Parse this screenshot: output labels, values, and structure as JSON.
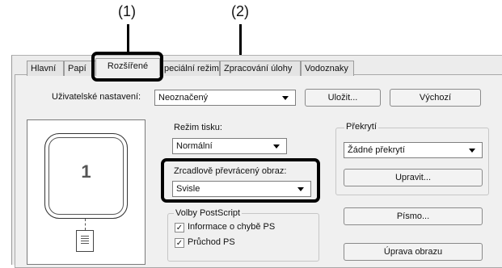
{
  "callouts": [
    "(1)",
    "(2)"
  ],
  "tabs": [
    {
      "label": "Hlavní"
    },
    {
      "label": "Papí"
    },
    {
      "label": "Rozšířené"
    },
    {
      "label": "peciální režimy"
    },
    {
      "label": "Zpracování úlohy"
    },
    {
      "label": "Vodoznaky"
    }
  ],
  "user_settings": {
    "label": "Uživatelské nastavení:",
    "value": "Neoznačený",
    "save_button": "Uložit...",
    "default_button": "Výchozí"
  },
  "preview": {
    "page_number": "1"
  },
  "print_mode": {
    "label": "Režim tisku:",
    "value": "Normální"
  },
  "mirror": {
    "label": "Zrcadlově převrácený obraz:",
    "value": "Svisle"
  },
  "postscript": {
    "group_label": "Volby PostScript",
    "items": [
      {
        "label": "Informace o chybě PS",
        "checked": true
      },
      {
        "label": "Průchod PS",
        "checked": true
      }
    ]
  },
  "overlay": {
    "group_label": "Překrytí",
    "value": "Žádné překrytí",
    "edit_button": "Upravit..."
  },
  "font_button": "Písmo...",
  "image_adjust_button": "Úprava obrazu"
}
